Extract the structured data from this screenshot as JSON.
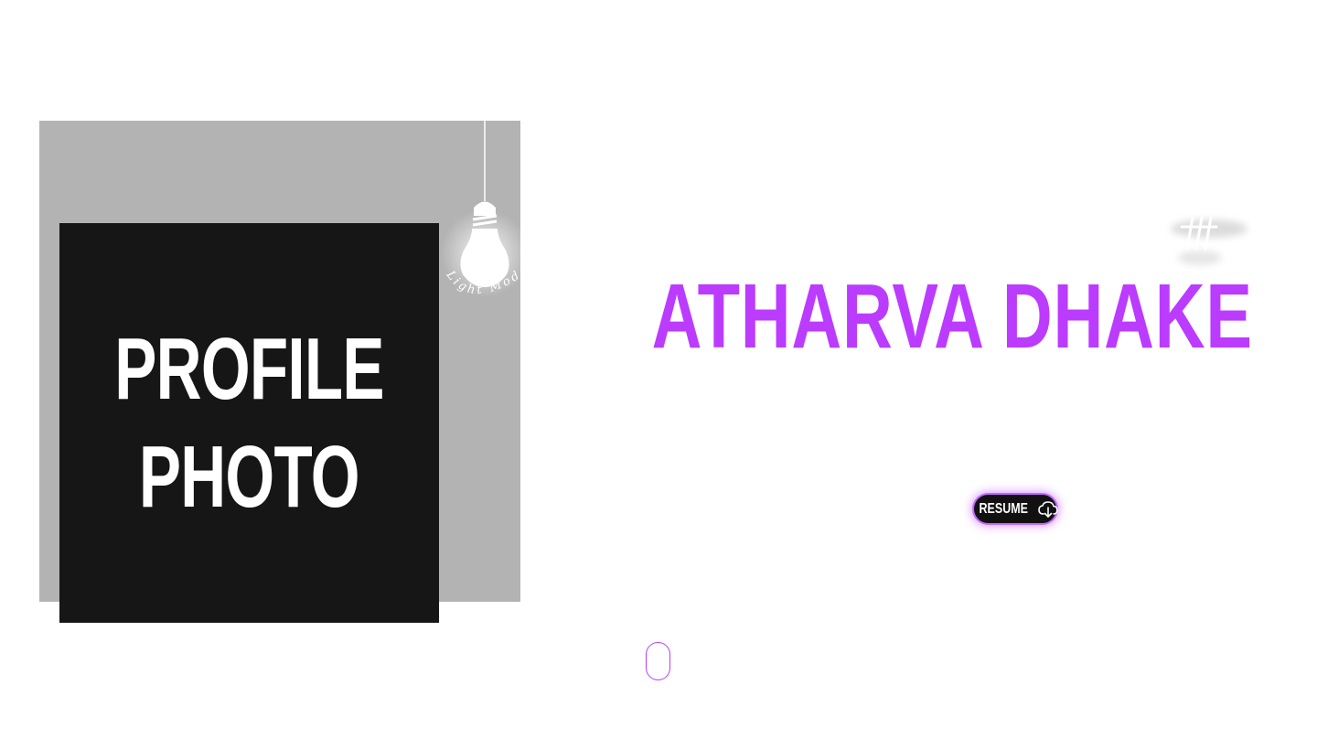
{
  "profile": {
    "line1": "PROFILE",
    "line2": "PHOTO"
  },
  "theme_toggle": {
    "label": "Light Mode",
    "icon": "lightbulb-icon"
  },
  "hero": {
    "name": "ATHARVA DHAKE"
  },
  "resume": {
    "label": "RESUME",
    "icon": "cloud-download-icon"
  },
  "scroll": {
    "icon": "mouse-scroll-icon"
  },
  "colors": {
    "accent": "#bb3bff",
    "background": "#ffffff",
    "panel_grey": "#b3b3b3",
    "card_dark": "#161616"
  }
}
